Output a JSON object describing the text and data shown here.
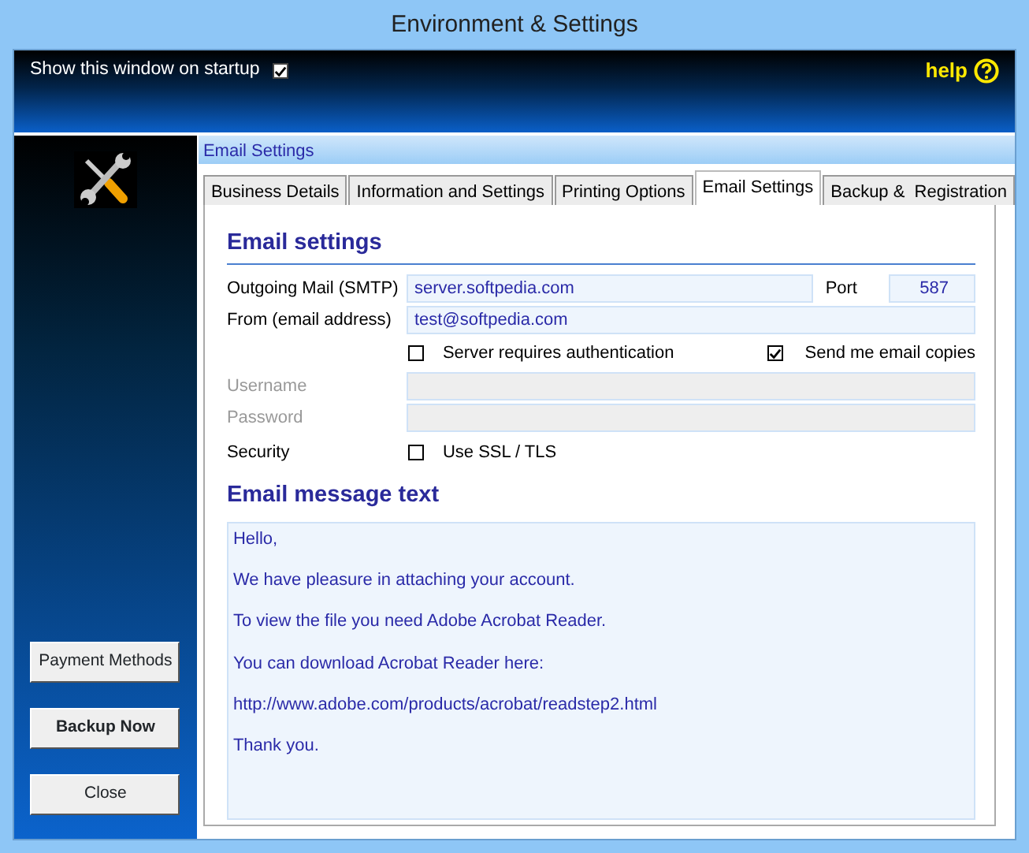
{
  "window": {
    "title": "Environment & Settings"
  },
  "header": {
    "startup_label": "Show this window on startup",
    "startup_checked": true,
    "help_label": "help"
  },
  "sidebar": {
    "buttons": [
      {
        "label": "Payment Methods",
        "bold": false
      },
      {
        "label": "Backup Now",
        "bold": true
      },
      {
        "label": "Close",
        "bold": false
      }
    ]
  },
  "panel": {
    "caption": "Email Settings"
  },
  "tabs": [
    {
      "label": "Business Details",
      "selected": false
    },
    {
      "label": "Information and Settings",
      "selected": false
    },
    {
      "label": "Printing Options",
      "selected": false
    },
    {
      "label": "Email Settings",
      "selected": true
    },
    {
      "label": "Backup &  Registration",
      "selected": false
    }
  ],
  "email_settings": {
    "heading": "Email settings",
    "smtp": {
      "label": "Outgoing Mail (SMTP)",
      "value": "server.softpedia.com"
    },
    "port": {
      "label": "Port",
      "value": "587"
    },
    "from": {
      "label": "From (email address)",
      "value": "test@softpedia.com"
    },
    "auth": {
      "label": "Server requires authentication",
      "checked": false
    },
    "copies": {
      "label": "Send me email copies",
      "checked": true
    },
    "username": {
      "label": "Username",
      "disabled": true
    },
    "password": {
      "label": "Password",
      "disabled": true
    },
    "security": {
      "label": "Security",
      "ssl_label": "Use SSL / TLS",
      "ssl_checked": false
    }
  },
  "message": {
    "heading": "Email message text",
    "lines": [
      "Hello,",
      "We have pleasure in attaching your account.",
      "To view the file you need Adobe Acrobat Reader.",
      "You can download Acrobat Reader here:",
      "http://www.adobe.com/products/acrobat/readstep2.html",
      "Thank you."
    ]
  }
}
